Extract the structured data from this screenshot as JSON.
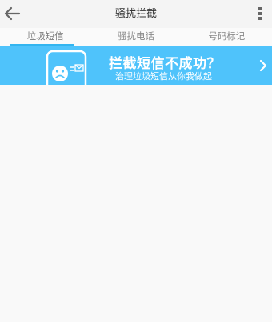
{
  "header": {
    "title": "骚扰拦截",
    "back_icon": "back-arrow-icon",
    "menu_icon": "more-vertical-icon"
  },
  "tabs": [
    {
      "label": "垃圾短信",
      "active": true
    },
    {
      "label": "骚扰电话",
      "active": false
    },
    {
      "label": "号码标记",
      "active": false
    }
  ],
  "banner": {
    "title": "拦截短信不成功？",
    "subtitle": "治理垃圾短信从你我做起",
    "illustration_icon": "sad-phone-icon",
    "arrow_icon": "chevron-right-icon"
  },
  "colors": {
    "accent": "#33b5f0",
    "banner_bg": "#4fc3fb",
    "background": "#f9f9f9"
  }
}
